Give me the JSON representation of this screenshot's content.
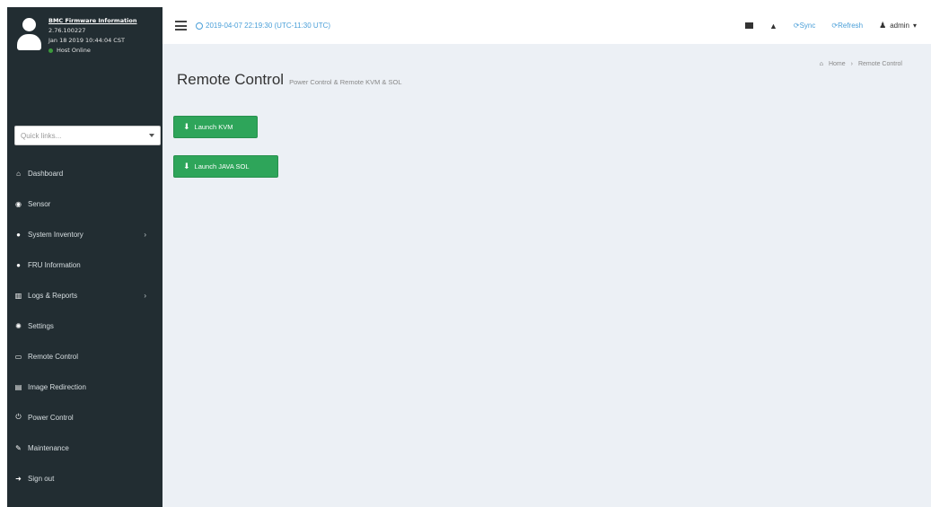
{
  "user_panel": {
    "fw_title": "BMC Firmware Information",
    "fw_version": "2.76.100227",
    "fw_date": "Jan 18 2019 10:44:04 CST",
    "host_status": "Host Online"
  },
  "quicklinks": {
    "placeholder": "Quick links..."
  },
  "menu": {
    "items": [
      {
        "label": "Dashboard",
        "icon": "dashboard-icon"
      },
      {
        "label": "Sensor",
        "icon": "sensor-icon"
      },
      {
        "label": "System Inventory",
        "icon": "info-icon"
      },
      {
        "label": "FRU Information",
        "icon": "info-icon"
      },
      {
        "label": "Logs & Reports",
        "icon": "chart-icon"
      },
      {
        "label": "Settings",
        "icon": "gear-icon"
      },
      {
        "label": "Remote Control",
        "icon": "monitor-icon"
      },
      {
        "label": "Image Redirection",
        "icon": "disk-icon"
      },
      {
        "label": "Power Control",
        "icon": "power-icon"
      },
      {
        "label": "Maintenance",
        "icon": "wrench-icon"
      },
      {
        "label": "Sign out",
        "icon": "sign-out-icon"
      }
    ]
  },
  "header": {
    "datetime": "2019-04-07 22:19:30 (UTC-11:30 UTC)",
    "sync_label": "Sync",
    "refresh_label": "Refresh",
    "user_label": "admin"
  },
  "page": {
    "title": "Remote Control",
    "subtitle": "Power Control & Remote KVM & SOL",
    "breadcrumb_home": "Home",
    "breadcrumb_current": "Remote Control"
  },
  "actions": {
    "launch_kvm": "Launch KVM",
    "launch_java_sol": "Launch JAVA SOL"
  },
  "colors": {
    "sidebar_bg": "#222d32",
    "content_bg": "#ecf0f5",
    "accent_blue": "#4a9fd8",
    "button_green": "#2ea55a"
  }
}
